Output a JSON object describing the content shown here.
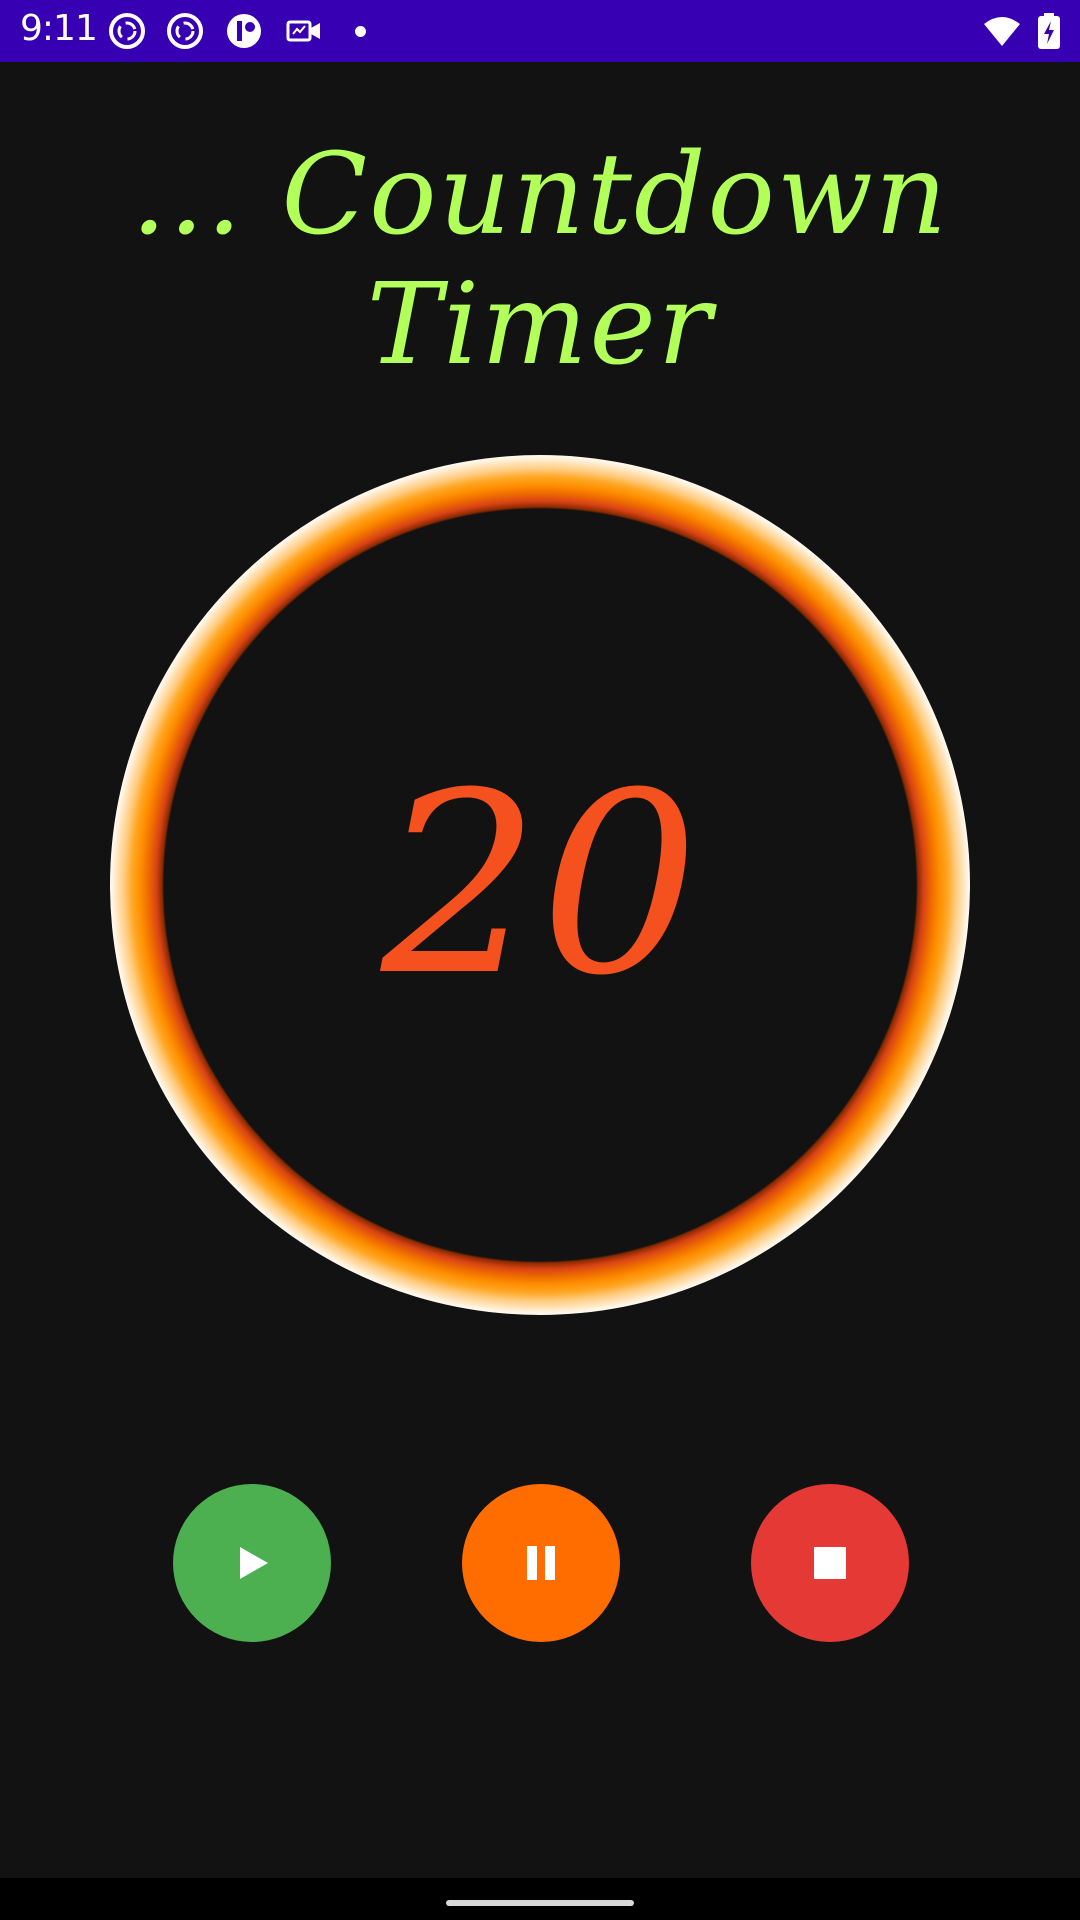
{
  "status_bar": {
    "time": "9:11",
    "background": "#3700B3",
    "left_icons": [
      "sync-circle-icon",
      "sync-circle-icon",
      "app-toggle-icon",
      "video-call-icon",
      "notification-dot-icon"
    ],
    "right_icons": [
      "wifi-icon",
      "battery-charging-icon"
    ]
  },
  "app": {
    "title": "... Countdown Timer",
    "title_color": "#B2FF59",
    "countdown_value": "20",
    "countdown_color": "#F4511E",
    "ring_color": "#FF8F00",
    "background": "#121212"
  },
  "controls": [
    {
      "name": "play-button",
      "icon": "play-icon",
      "color": "#4CAF50"
    },
    {
      "name": "pause-button",
      "icon": "pause-icon",
      "color": "#FF6D00"
    },
    {
      "name": "stop-button",
      "icon": "stop-icon",
      "color": "#E53935"
    }
  ],
  "nav_bar": {
    "handle": "gesture-handle"
  }
}
